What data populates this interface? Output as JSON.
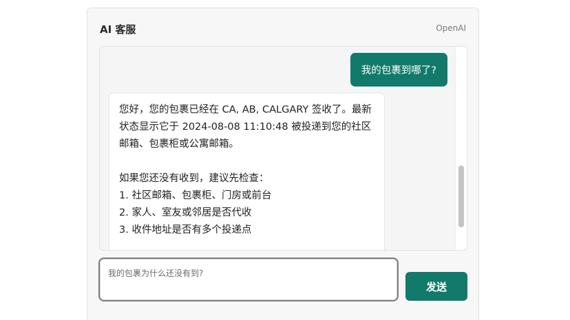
{
  "header": {
    "title": "AI 客服",
    "brand": "OpenAI"
  },
  "messages": [
    {
      "role": "user",
      "text": "我的包裹到哪了?"
    },
    {
      "role": "assistant",
      "text": "您好，您的包裹已经在 CA, AB, CALGARY 签收了。最新状态显示它于 2024-08-08 11:10:48 被投递到您的社区邮箱、包裹柜或公寓邮箱。\n\n如果您还没有收到，建议先检查：\n1. 社区邮箱、包裹柜、门房或前台\n2. 家人、室友或邻居是否代收\n3. 收件地址是否有多个投递点"
    }
  ],
  "composer": {
    "placeholder": "我的包裹为什么还没有到?",
    "value": "",
    "send_label": "发送"
  },
  "colors": {
    "accent": "#127a6b"
  }
}
